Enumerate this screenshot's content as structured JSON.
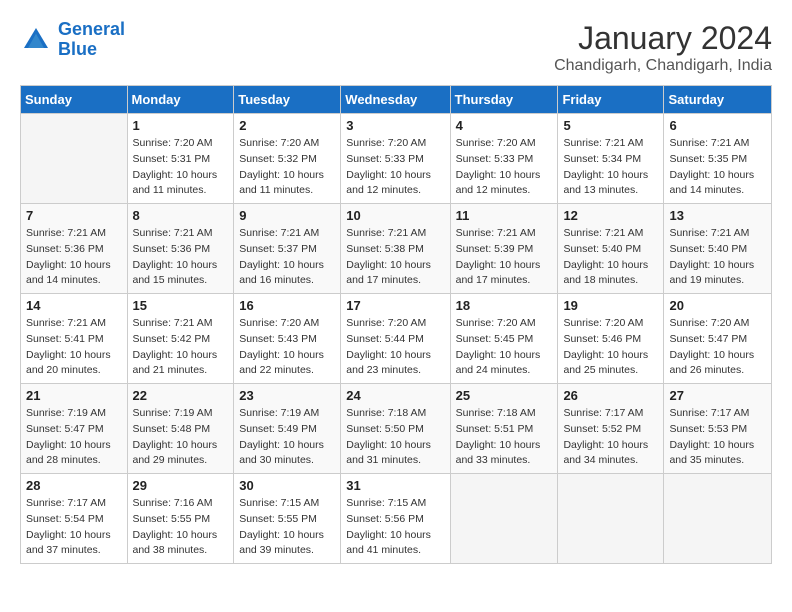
{
  "header": {
    "logo_line1": "General",
    "logo_line2": "Blue",
    "month_title": "January 2024",
    "subtitle": "Chandigarh, Chandigarh, India"
  },
  "days_of_week": [
    "Sunday",
    "Monday",
    "Tuesday",
    "Wednesday",
    "Thursday",
    "Friday",
    "Saturday"
  ],
  "weeks": [
    [
      {
        "day": "",
        "info": ""
      },
      {
        "day": "1",
        "info": "Sunrise: 7:20 AM\nSunset: 5:31 PM\nDaylight: 10 hours\nand 11 minutes."
      },
      {
        "day": "2",
        "info": "Sunrise: 7:20 AM\nSunset: 5:32 PM\nDaylight: 10 hours\nand 11 minutes."
      },
      {
        "day": "3",
        "info": "Sunrise: 7:20 AM\nSunset: 5:33 PM\nDaylight: 10 hours\nand 12 minutes."
      },
      {
        "day": "4",
        "info": "Sunrise: 7:20 AM\nSunset: 5:33 PM\nDaylight: 10 hours\nand 12 minutes."
      },
      {
        "day": "5",
        "info": "Sunrise: 7:21 AM\nSunset: 5:34 PM\nDaylight: 10 hours\nand 13 minutes."
      },
      {
        "day": "6",
        "info": "Sunrise: 7:21 AM\nSunset: 5:35 PM\nDaylight: 10 hours\nand 14 minutes."
      }
    ],
    [
      {
        "day": "7",
        "info": "Sunrise: 7:21 AM\nSunset: 5:36 PM\nDaylight: 10 hours\nand 14 minutes."
      },
      {
        "day": "8",
        "info": "Sunrise: 7:21 AM\nSunset: 5:36 PM\nDaylight: 10 hours\nand 15 minutes."
      },
      {
        "day": "9",
        "info": "Sunrise: 7:21 AM\nSunset: 5:37 PM\nDaylight: 10 hours\nand 16 minutes."
      },
      {
        "day": "10",
        "info": "Sunrise: 7:21 AM\nSunset: 5:38 PM\nDaylight: 10 hours\nand 17 minutes."
      },
      {
        "day": "11",
        "info": "Sunrise: 7:21 AM\nSunset: 5:39 PM\nDaylight: 10 hours\nand 17 minutes."
      },
      {
        "day": "12",
        "info": "Sunrise: 7:21 AM\nSunset: 5:40 PM\nDaylight: 10 hours\nand 18 minutes."
      },
      {
        "day": "13",
        "info": "Sunrise: 7:21 AM\nSunset: 5:40 PM\nDaylight: 10 hours\nand 19 minutes."
      }
    ],
    [
      {
        "day": "14",
        "info": "Sunrise: 7:21 AM\nSunset: 5:41 PM\nDaylight: 10 hours\nand 20 minutes."
      },
      {
        "day": "15",
        "info": "Sunrise: 7:21 AM\nSunset: 5:42 PM\nDaylight: 10 hours\nand 21 minutes."
      },
      {
        "day": "16",
        "info": "Sunrise: 7:20 AM\nSunset: 5:43 PM\nDaylight: 10 hours\nand 22 minutes."
      },
      {
        "day": "17",
        "info": "Sunrise: 7:20 AM\nSunset: 5:44 PM\nDaylight: 10 hours\nand 23 minutes."
      },
      {
        "day": "18",
        "info": "Sunrise: 7:20 AM\nSunset: 5:45 PM\nDaylight: 10 hours\nand 24 minutes."
      },
      {
        "day": "19",
        "info": "Sunrise: 7:20 AM\nSunset: 5:46 PM\nDaylight: 10 hours\nand 25 minutes."
      },
      {
        "day": "20",
        "info": "Sunrise: 7:20 AM\nSunset: 5:47 PM\nDaylight: 10 hours\nand 26 minutes."
      }
    ],
    [
      {
        "day": "21",
        "info": "Sunrise: 7:19 AM\nSunset: 5:47 PM\nDaylight: 10 hours\nand 28 minutes."
      },
      {
        "day": "22",
        "info": "Sunrise: 7:19 AM\nSunset: 5:48 PM\nDaylight: 10 hours\nand 29 minutes."
      },
      {
        "day": "23",
        "info": "Sunrise: 7:19 AM\nSunset: 5:49 PM\nDaylight: 10 hours\nand 30 minutes."
      },
      {
        "day": "24",
        "info": "Sunrise: 7:18 AM\nSunset: 5:50 PM\nDaylight: 10 hours\nand 31 minutes."
      },
      {
        "day": "25",
        "info": "Sunrise: 7:18 AM\nSunset: 5:51 PM\nDaylight: 10 hours\nand 33 minutes."
      },
      {
        "day": "26",
        "info": "Sunrise: 7:17 AM\nSunset: 5:52 PM\nDaylight: 10 hours\nand 34 minutes."
      },
      {
        "day": "27",
        "info": "Sunrise: 7:17 AM\nSunset: 5:53 PM\nDaylight: 10 hours\nand 35 minutes."
      }
    ],
    [
      {
        "day": "28",
        "info": "Sunrise: 7:17 AM\nSunset: 5:54 PM\nDaylight: 10 hours\nand 37 minutes."
      },
      {
        "day": "29",
        "info": "Sunrise: 7:16 AM\nSunset: 5:55 PM\nDaylight: 10 hours\nand 38 minutes."
      },
      {
        "day": "30",
        "info": "Sunrise: 7:15 AM\nSunset: 5:55 PM\nDaylight: 10 hours\nand 39 minutes."
      },
      {
        "day": "31",
        "info": "Sunrise: 7:15 AM\nSunset: 5:56 PM\nDaylight: 10 hours\nand 41 minutes."
      },
      {
        "day": "",
        "info": ""
      },
      {
        "day": "",
        "info": ""
      },
      {
        "day": "",
        "info": ""
      }
    ]
  ]
}
